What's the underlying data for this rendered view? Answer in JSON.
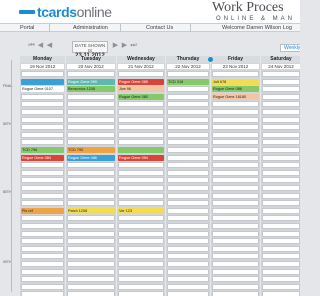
{
  "header": {
    "logo_t1": "tcards",
    "logo_t2": "online",
    "brand_line1": "Work Proces",
    "brand_line2": "ONLINE & MAN"
  },
  "nav": {
    "items": [
      "Portal",
      "Administration",
      "Contact Us"
    ],
    "welcome": "Welcome Darren Wilson Log"
  },
  "toolbar": {
    "date_label": "DATE SHOWN IS",
    "date_value": "23.11.2012",
    "weekly_label": "Weekly Planner",
    "buttons": [
      "first-page",
      "prev-page",
      "prev",
      "next",
      "next-page",
      "last-page"
    ]
  },
  "gutter": {
    "markers": [
      "FINAL",
      "50TH",
      "80TH",
      "90TH"
    ]
  },
  "colors": {
    "accent": "#1b8bd4",
    "blue": "#3aa0d8",
    "green": "#86c96a",
    "red": "#d9443a",
    "orange": "#f0a341",
    "yellow": "#f2dc52",
    "peach": "#f4c5a2",
    "teal": "#5db8b2"
  },
  "days": [
    {
      "name": "Monday",
      "date": "19 Nov 2012",
      "cards": [
        {
          "slot": 1,
          "label": "",
          "color": "#3aa0d8"
        },
        {
          "slot": 2,
          "label": "Rogue Gene 0107",
          "color": "#ffffff"
        },
        {
          "slot": 10,
          "label": "TCD 796",
          "color": "#86c96a"
        },
        {
          "slot": 11,
          "label": "Rogue Gene 084",
          "color": "#d9443a"
        },
        {
          "slot": 18,
          "label": "Pix ref",
          "color": "#f0a341"
        }
      ]
    },
    {
      "name": "Tuesday",
      "date": "20 Nov 2012",
      "cards": [
        {
          "slot": 1,
          "label": "Rogue Gene 090",
          "color": "#5db8b2"
        },
        {
          "slot": 2,
          "label": "Bensonics 1208",
          "color": "#86c96a"
        },
        {
          "slot": 10,
          "label": "TCD 790",
          "color": "#f0a341"
        },
        {
          "slot": 11,
          "label": "Rogue Gene 086",
          "color": "#3aa0d8"
        },
        {
          "slot": 18,
          "label": "Patch 1208",
          "color": "#f2dc52"
        }
      ]
    },
    {
      "name": "Wednesday",
      "date": "21 Nov 2012",
      "cards": [
        {
          "slot": 1,
          "label": "Rogue Gene 089",
          "color": "#d9443a"
        },
        {
          "slot": 2,
          "label": "Jive 96",
          "color": "#f4c5a2"
        },
        {
          "slot": 3,
          "label": "Rogue Gene 080",
          "color": "#86c96a"
        },
        {
          "slot": 10,
          "label": "",
          "color": "#86c96a"
        },
        {
          "slot": 11,
          "label": "Rogue Gene 094",
          "color": "#d9443a"
        },
        {
          "slot": 18,
          "label": "Ver 123",
          "color": "#f2dc52"
        }
      ]
    },
    {
      "name": "Thursday",
      "date": "22 Nov 2012",
      "cards": [
        {
          "slot": 1,
          "label": "TCD 318",
          "color": "#86c96a"
        }
      ]
    },
    {
      "name": "Friday",
      "date": "23 Nov 2012",
      "cards": [
        {
          "slot": 1,
          "label": "Jolt 678",
          "color": "#f2dc52"
        },
        {
          "slot": 2,
          "label": "Rogue Gene 086",
          "color": "#86c96a"
        },
        {
          "slot": 3,
          "label": "Rogue Gene 16180",
          "color": "#f4c5a2"
        }
      ]
    },
    {
      "name": "Saturday",
      "date": "24 Nov 2012",
      "cards": []
    }
  ]
}
